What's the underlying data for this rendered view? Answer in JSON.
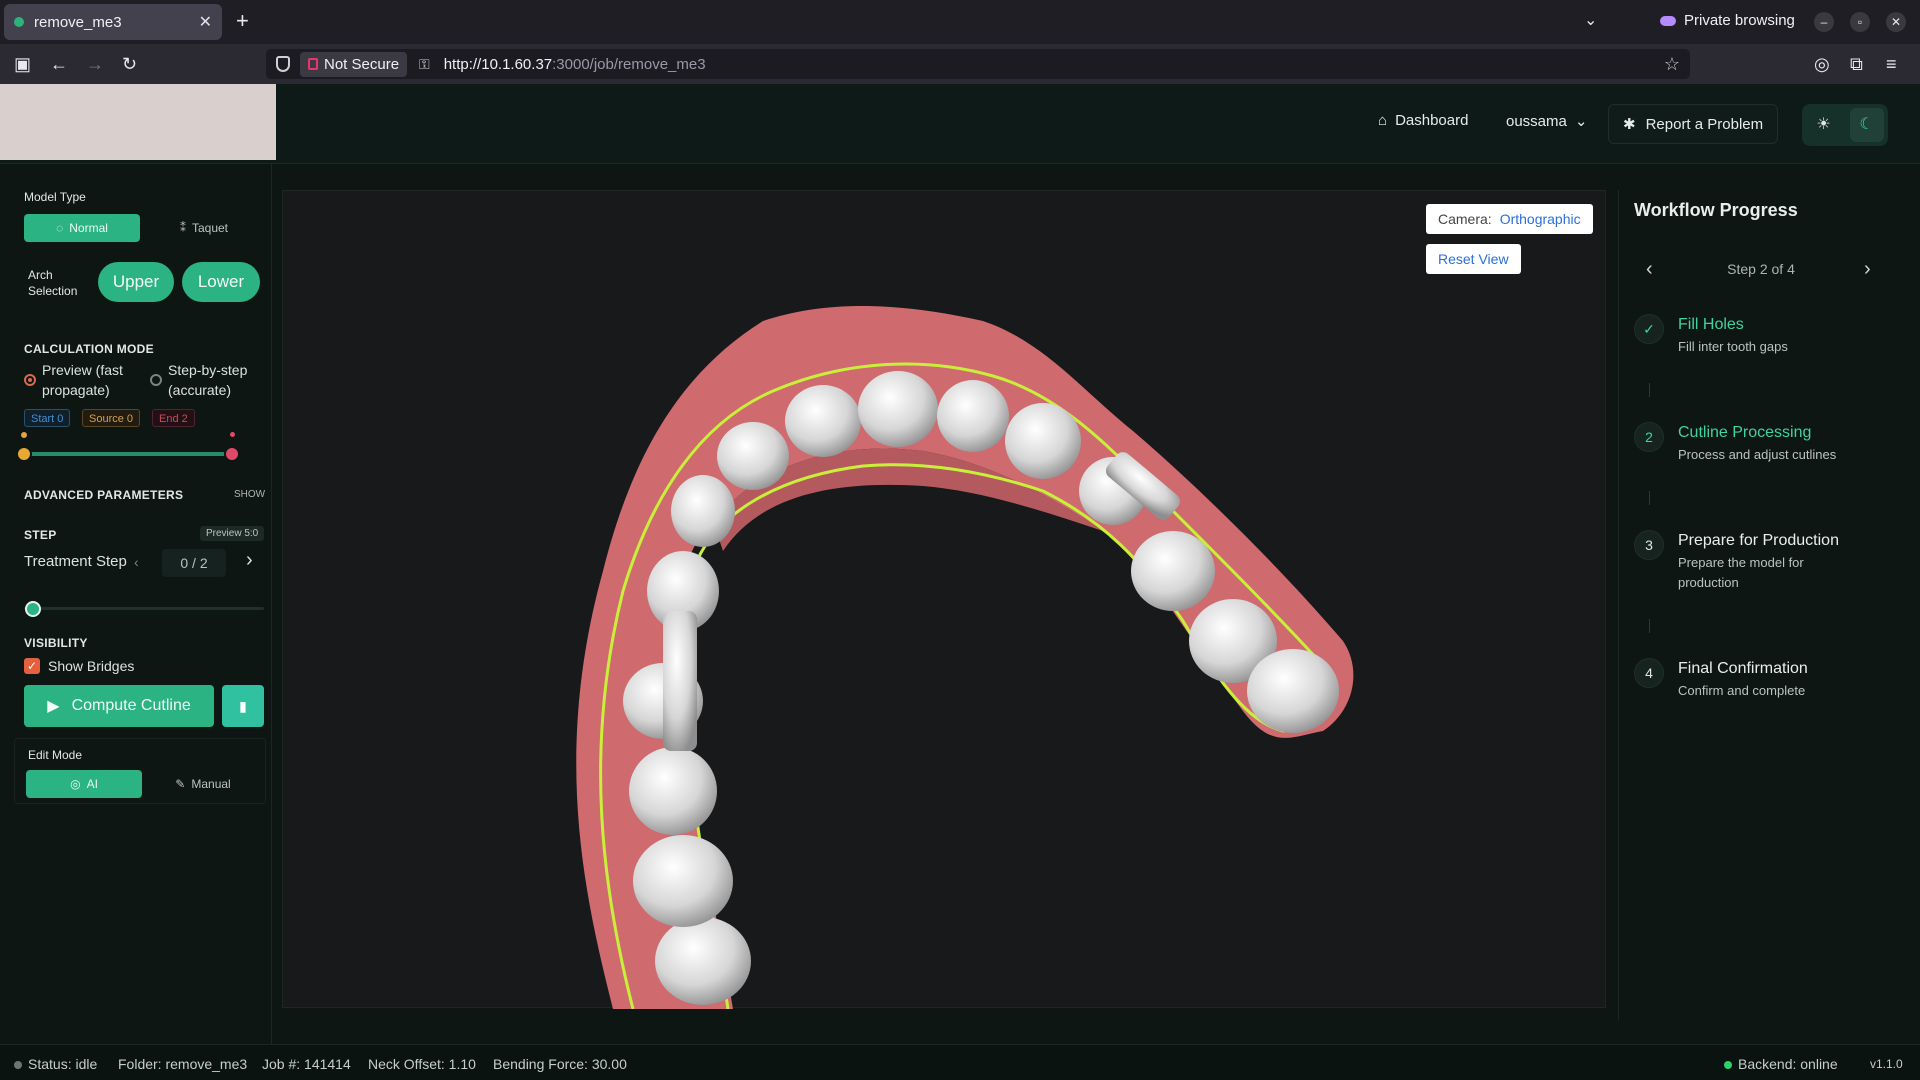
{
  "browser": {
    "tab_title": "remove_me3",
    "new_tab": "+",
    "private_label": "Private browsing",
    "not_secure": "Not Secure",
    "url_host": "http://10.1.60.37",
    "url_path": ":3000/job/remove_me3"
  },
  "header": {
    "dashboard": "Dashboard",
    "user": "oussama",
    "report": "Report a Problem"
  },
  "left": {
    "model_type_label": "Model Type",
    "model_normal": "Normal",
    "model_taquet": "Taquet",
    "arch_label_1": "Arch",
    "arch_label_2": "Selection",
    "arch_upper": "Upper",
    "arch_lower": "Lower",
    "calc_mode_label": "CALCULATION MODE",
    "preview_1": "Preview (fast",
    "preview_2": "propagate)",
    "stepbystep_1": "Step-by-step",
    "stepbystep_2": "(accurate)",
    "chip_start": "Start 0",
    "chip_source": "Source 0",
    "chip_end": "End 2",
    "advanced_label": "ADVANCED PARAMETERS",
    "advanced_toggle": "SHOW",
    "step_label": "STEP",
    "step_badge": "Preview 5:0",
    "treatment_step": "Treatment Step",
    "treatment_value": "0 / 2",
    "visibility_label": "VISIBILITY",
    "show_bridges": "Show Bridges",
    "compute": "Compute Cutline",
    "edit_mode_label": "Edit Mode",
    "edit_ai": "AI",
    "edit_manual": "Manual"
  },
  "viewport": {
    "camera_label": "Camera:",
    "camera_value": "Orthographic",
    "reset_view": "Reset View"
  },
  "workflow": {
    "title": "Workflow Progress",
    "step_of": "Step 2 of 4",
    "steps": [
      {
        "num": "✓",
        "title": "Fill Holes",
        "desc": "Fill inter tooth gaps",
        "state": "done"
      },
      {
        "num": "2",
        "title": "Cutline Processing",
        "desc": "Process and adjust cutlines",
        "state": "active"
      },
      {
        "num": "3",
        "title": "Prepare for Production",
        "desc": "Prepare the model for production",
        "state": "todo"
      },
      {
        "num": "4",
        "title": "Final Confirmation",
        "desc": "Confirm and complete",
        "state": "todo"
      }
    ]
  },
  "status": {
    "state": "Status: idle",
    "folder": "Folder: remove_me3",
    "job": "Job #: 141414",
    "neck": "Neck Offset: 1.10",
    "bending": "Bending Force: 30.00",
    "backend": "Backend: online",
    "version": "v1.1.0"
  },
  "colors": {
    "accent": "#2bb383",
    "cutline": "#c8f03a",
    "gum": "#cf6a6e",
    "done_title": "#3ed3a0"
  }
}
